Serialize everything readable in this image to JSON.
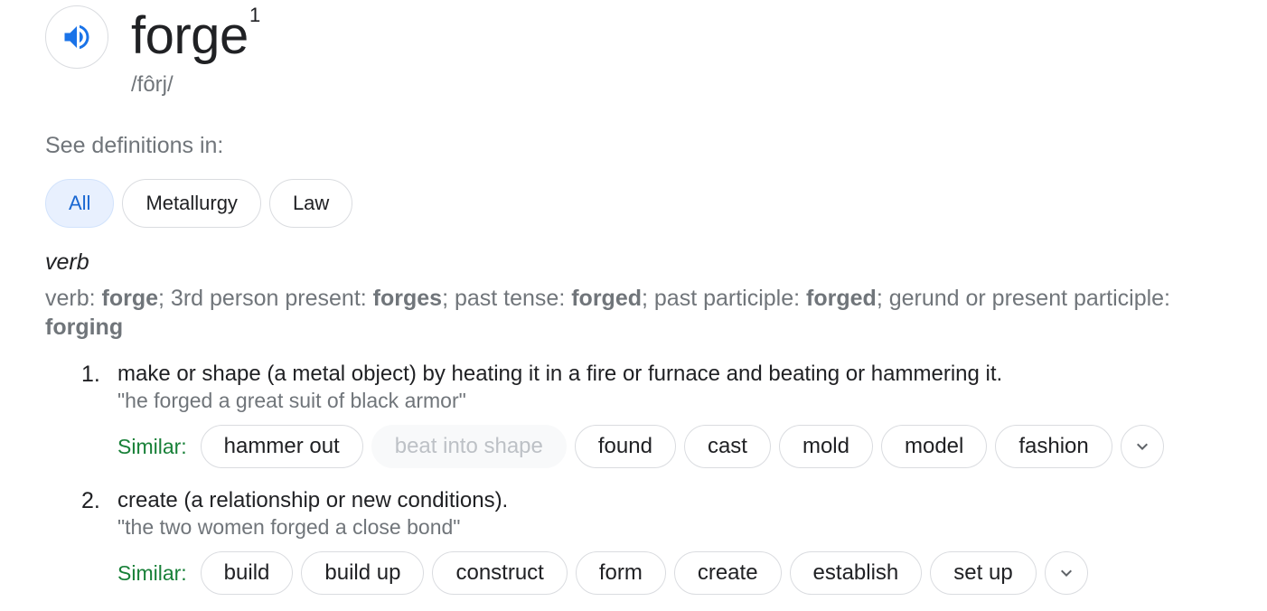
{
  "entry": {
    "word": "forge",
    "homograph": "1",
    "phonetic": "/fôrj/",
    "speaker_icon": "speaker-icon"
  },
  "see_definitions": {
    "label": "See definitions in:",
    "chips": [
      {
        "label": "All",
        "selected": true
      },
      {
        "label": "Metallurgy",
        "selected": false
      },
      {
        "label": "Law",
        "selected": false
      }
    ]
  },
  "part_of_speech": "verb",
  "forms": {
    "verb_label": "verb: ",
    "verb": "forge",
    "third_label": "; 3rd person present: ",
    "third": "forges",
    "past_label": "; past tense: ",
    "past": "forged",
    "pp_label": "; past participle: ",
    "pp": "forged",
    "gerund_label": "; gerund or present participle: ",
    "gerund": "forging"
  },
  "similar_label": "Similar:",
  "definitions": [
    {
      "number": "1.",
      "text": "make or shape (a metal object) by heating it in a fire or furnace and beating or hammering it.",
      "example": "\"he forged a great suit of black armor\"",
      "similar": [
        "hammer out",
        "beat into shape",
        "found",
        "cast",
        "mold",
        "model",
        "fashion"
      ],
      "disabled_similar": "beat into shape"
    },
    {
      "number": "2.",
      "text": "create (a relationship or new conditions).",
      "example": "\"the two women forged a close bond\"",
      "similar": [
        "build",
        "build up",
        "construct",
        "form",
        "create",
        "establish",
        "set up"
      ]
    }
  ],
  "icons": {
    "expand": "chevron-down-icon"
  },
  "colors": {
    "accent_blue": "#1a73e8",
    "similar_green": "#188038",
    "muted_gray": "#70757a",
    "chip_selected_bg": "#e8f0fe"
  }
}
